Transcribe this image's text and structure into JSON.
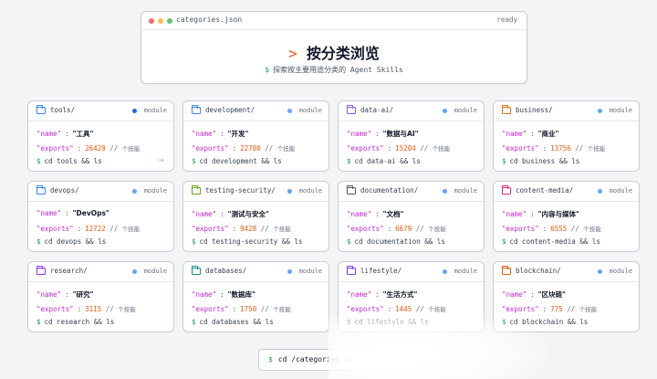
{
  "window": {
    "title": "categories.json",
    "status": "ready",
    "dot_colors": [
      "#f26b6b",
      "#f5c04f",
      "#5fc47a"
    ]
  },
  "hero": {
    "caret": ">",
    "title": "按分类浏览",
    "subtitle_prompt": "$",
    "subtitle": "探索按主要用途分类的 Agent Skills"
  },
  "labels": {
    "name_key": "\"name\"",
    "exports_key": "\"exports\"",
    "colon": ":",
    "comment_prefix": "//",
    "comment_suffix": "个技能",
    "prompt": "$",
    "module": "module"
  },
  "categories": [
    {
      "folder": "tools/",
      "name": "\"工具\"",
      "exports": "26429",
      "cmd": "cd tools && ls",
      "icon_color": "#3b82f6",
      "dot_color": "#2563eb"
    },
    {
      "folder": "development/",
      "name": "\"开发\"",
      "exports": "22780",
      "cmd": "cd development && ls",
      "icon_color": "#3b82f6",
      "dot_color": "#60a5fa"
    },
    {
      "folder": "data-ai/",
      "name": "\"数据与AI\"",
      "exports": "15204",
      "cmd": "cd data-ai && ls",
      "icon_color": "#8b5cf6",
      "dot_color": "#60a5fa"
    },
    {
      "folder": "business/",
      "name": "\"商业\"",
      "exports": "13756",
      "cmd": "cd business && ls",
      "icon_color": "#d97706",
      "dot_color": "#60a5fa"
    },
    {
      "folder": "devops/",
      "name": "\"DevOps\"",
      "exports": "12722",
      "cmd": "cd devops && ls",
      "icon_color": "#3b82f6",
      "dot_color": "#60a5fa"
    },
    {
      "folder": "testing-security/",
      "name": "\"测试与安全\"",
      "exports": "9428",
      "cmd": "cd testing-security && ls",
      "icon_color": "#65a30d",
      "dot_color": "#60a5fa"
    },
    {
      "folder": "documentation/",
      "name": "\"文档\"",
      "exports": "6679",
      "cmd": "cd documentation && ls",
      "icon_color": "#4b5563",
      "dot_color": "#60a5fa"
    },
    {
      "folder": "content-media/",
      "name": "\"内容与媒体\"",
      "exports": "6555",
      "cmd": "cd content-media && ls",
      "icon_color": "#db2777",
      "dot_color": "#60a5fa"
    },
    {
      "folder": "research/",
      "name": "\"研究\"",
      "exports": "3115",
      "cmd": "cd research && ls",
      "icon_color": "#9333ea",
      "dot_color": "#60a5fa"
    },
    {
      "folder": "databases/",
      "name": "\"数据库\"",
      "exports": "1750",
      "cmd": "cd databases && ls",
      "icon_color": "#0d9488",
      "dot_color": "#60a5fa"
    },
    {
      "folder": "lifestyle/",
      "name": "\"生活方式\"",
      "exports": "1445",
      "cmd": "cd lifestyle && ls",
      "icon_color": "#7c3aed",
      "dot_color": "#60a5fa"
    },
    {
      "folder": "blockchain/",
      "name": "\"区块链\"",
      "exports": "775",
      "cmd": "cd blockchain && ls",
      "icon_color": "#ea580c",
      "dot_color": "#60a5fa"
    }
  ],
  "first_card_arrow": "→",
  "bottom": {
    "prompt": "$",
    "command": "cd /categories && "
  }
}
